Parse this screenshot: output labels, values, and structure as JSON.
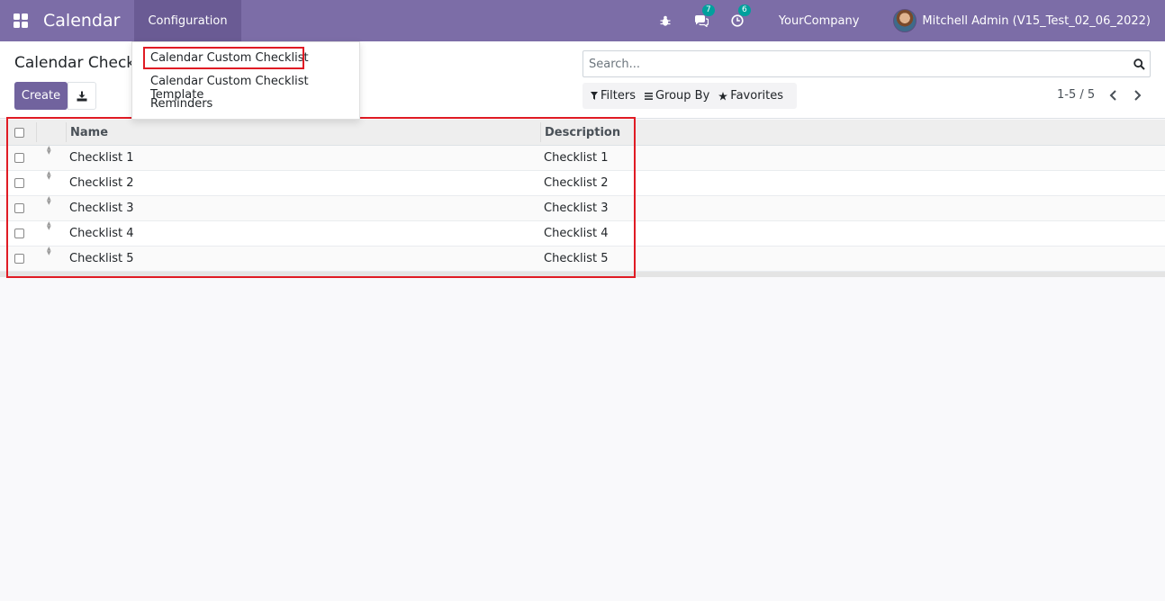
{
  "navbar": {
    "app_title": "Calendar",
    "menu_configuration": "Configuration",
    "messages_badge": "7",
    "activities_badge": "6",
    "company": "YourCompany",
    "user_name": "Mitchell Admin (V15_Test_02_06_2022)",
    "colors": {
      "background": "#7c6da7",
      "badge": "#00a09d"
    }
  },
  "dropdown": {
    "items": [
      {
        "label": "Calendar Custom Checklist",
        "highlighted": true
      },
      {
        "label": "Calendar Custom Checklist Template"
      },
      {
        "label": "Reminders"
      }
    ]
  },
  "control_panel": {
    "breadcrumb": "Calendar Check",
    "create_label": "Create",
    "search_placeholder": "Search...",
    "filters_label": "Filters",
    "group_by_label": "Group By",
    "favorites_label": "Favorites",
    "pager_value": "1-5 / 5"
  },
  "table": {
    "columns": [
      "Name",
      "Description"
    ],
    "rows": [
      {
        "name": "Checklist 1",
        "description": "Checklist 1"
      },
      {
        "name": "Checklist 2",
        "description": "Checklist 2"
      },
      {
        "name": "Checklist 3",
        "description": "Checklist 3"
      },
      {
        "name": "Checklist 4",
        "description": "Checklist 4"
      },
      {
        "name": "Checklist 5",
        "description": "Checklist 5"
      }
    ]
  },
  "annotations": {
    "highlight_color": "#e01b24"
  }
}
